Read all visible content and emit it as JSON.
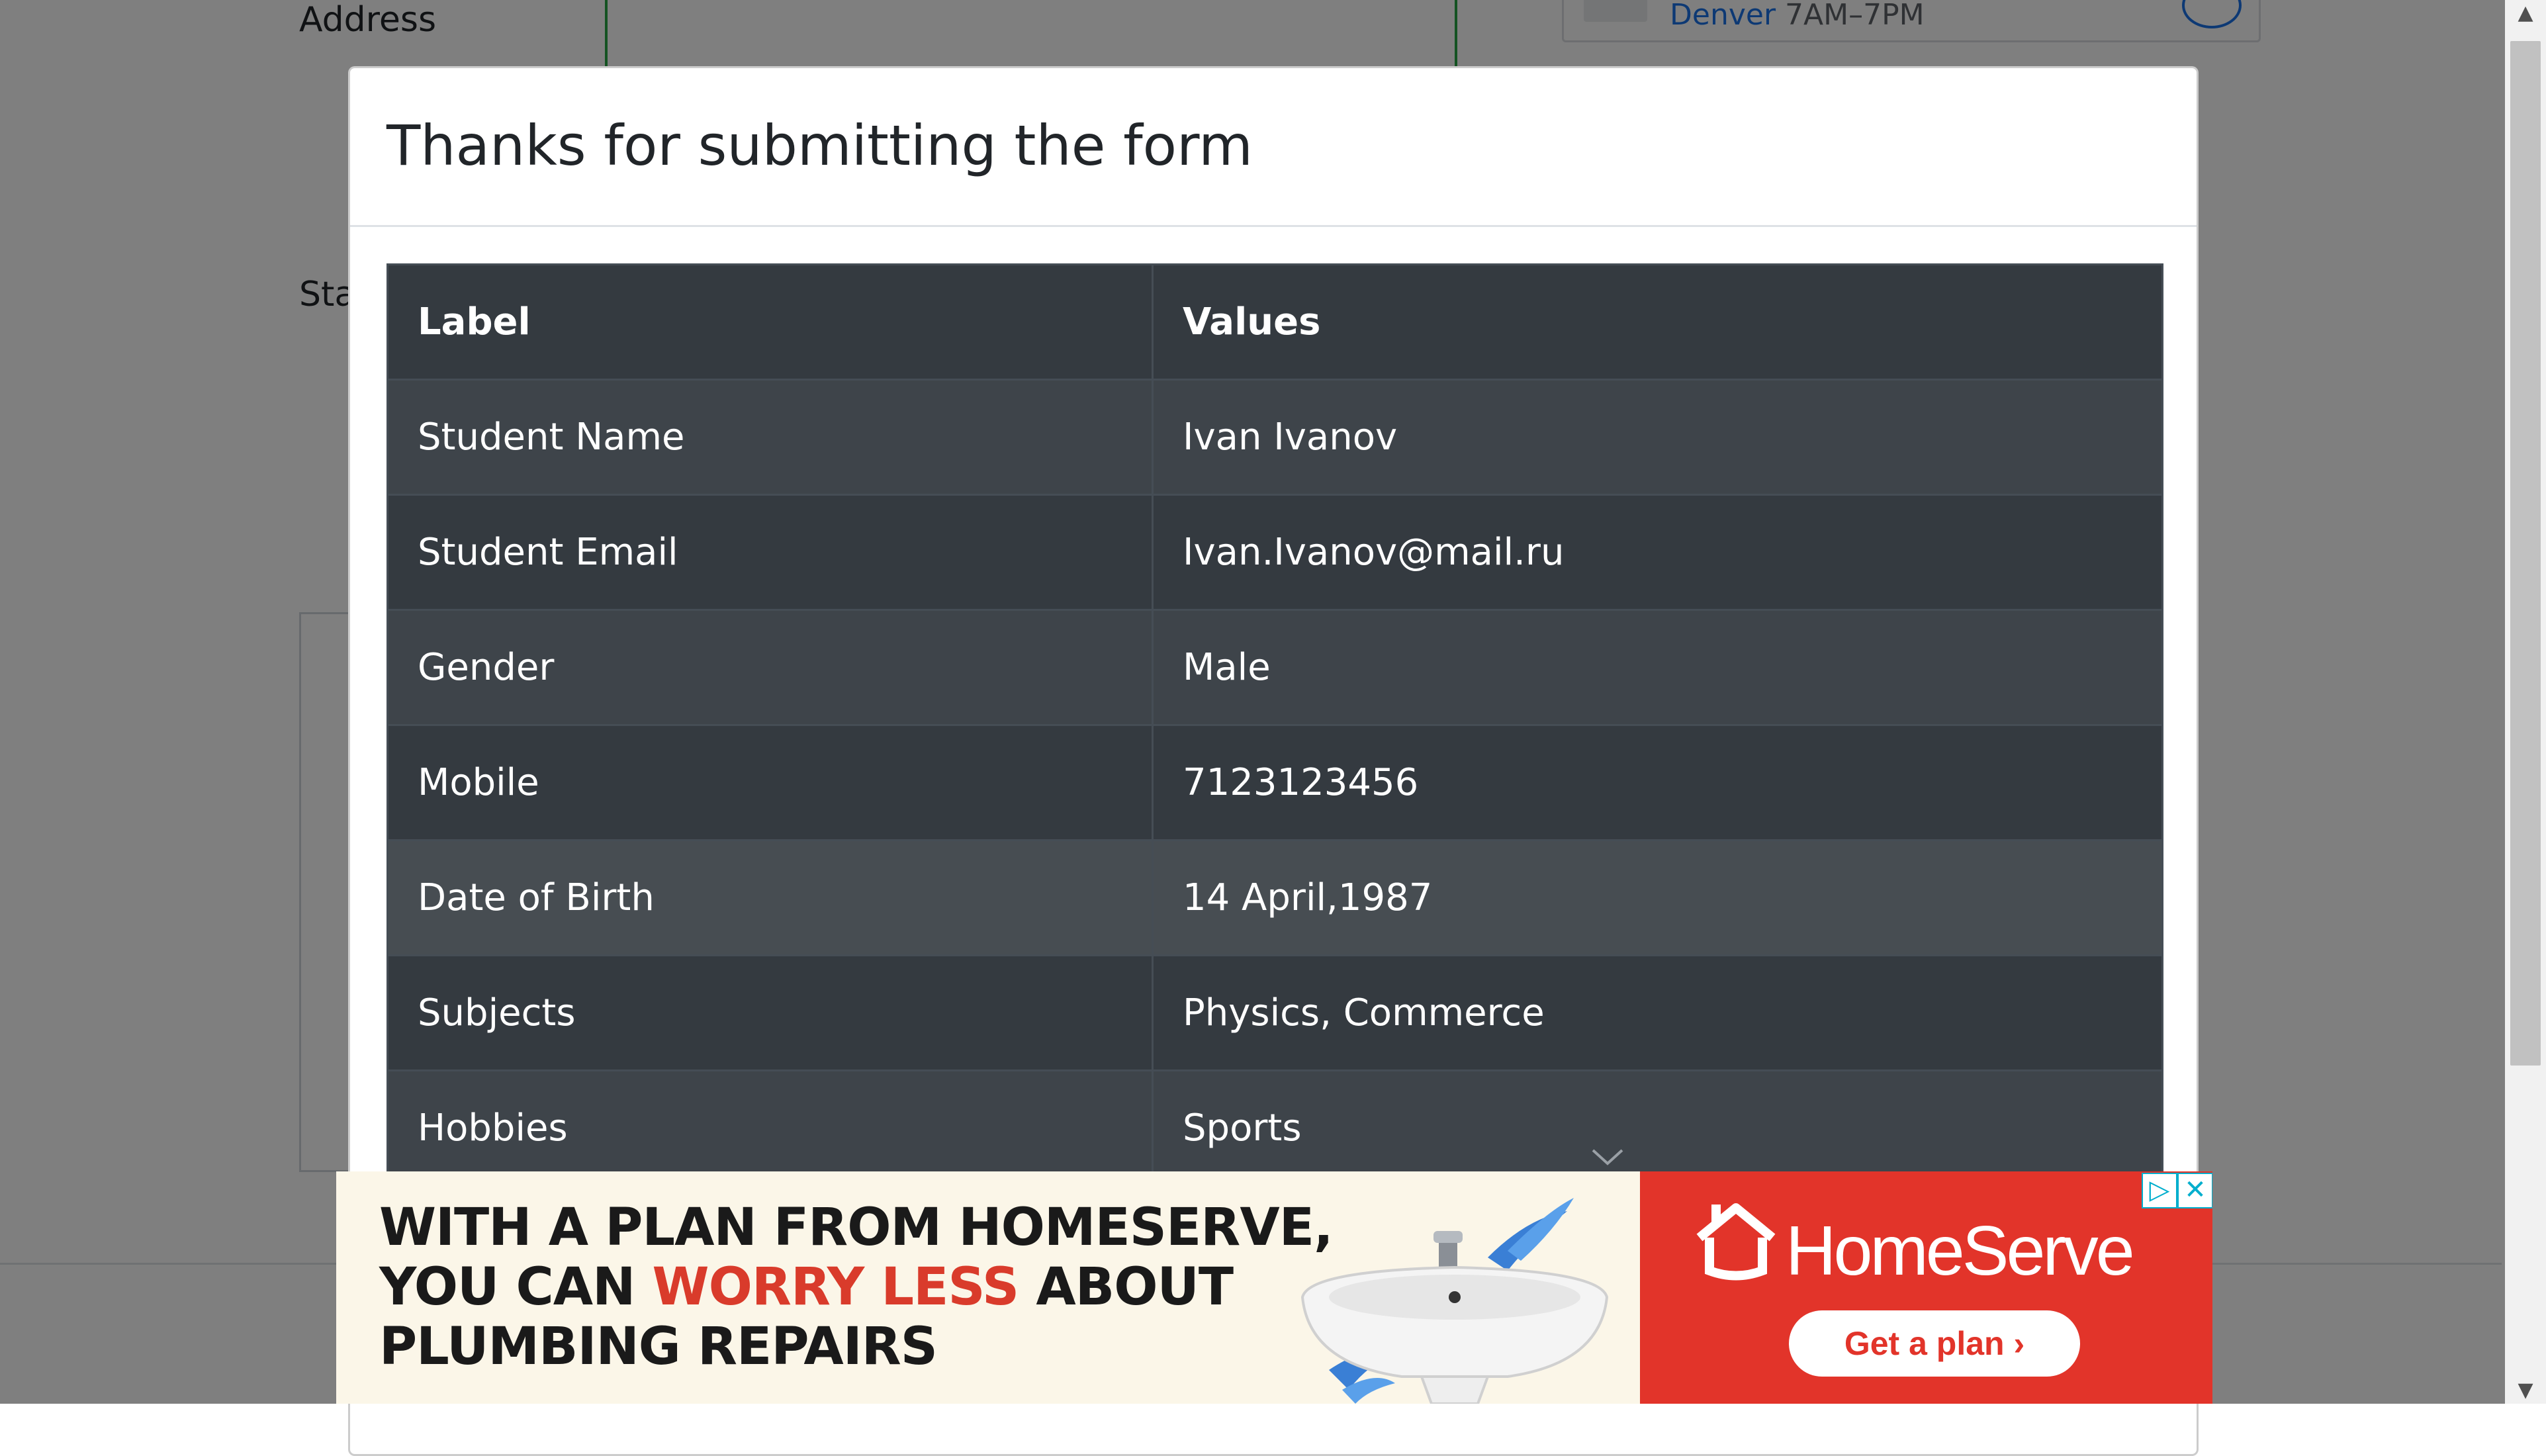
{
  "background_page": {
    "address_label": "Address",
    "state_label": "Sta",
    "map": {
      "city": "Denver",
      "hours": "7AM–7PM"
    }
  },
  "modal": {
    "title": "Thanks for submitting the form",
    "table": {
      "headers": [
        "Label",
        "Values"
      ],
      "rows": [
        {
          "label": "Student Name",
          "value": "Ivan Ivanov"
        },
        {
          "label": "Student Email",
          "value": "Ivan.Ivanov@mail.ru"
        },
        {
          "label": "Gender",
          "value": "Male"
        },
        {
          "label": "Mobile",
          "value": "7123123456"
        },
        {
          "label": "Date of Birth",
          "value": "14 April,1987"
        },
        {
          "label": "Subjects",
          "value": "Physics, Commerce"
        },
        {
          "label": "Hobbies",
          "value": "Sports"
        }
      ]
    }
  },
  "ad": {
    "headline_line1": "WITH A PLAN FROM HOMESERVE,",
    "headline_line2_a": "YOU CAN ",
    "headline_line2_accent": "WORRY LESS",
    "headline_line2_b": " ABOUT",
    "headline_line3": "PLUMBING REPAIRS",
    "brand": "HomeServe",
    "cta": "Get a plan ›",
    "adchoices": "▷",
    "close": "✕",
    "colors": {
      "brand_red": "#e2342a",
      "accent_red": "#d93b2b",
      "control_blue": "#00aecd"
    }
  },
  "colors": {
    "table_bg": "#343a40",
    "table_border": "#454d55",
    "backdrop": "rgba(0,0,0,0.5)"
  }
}
